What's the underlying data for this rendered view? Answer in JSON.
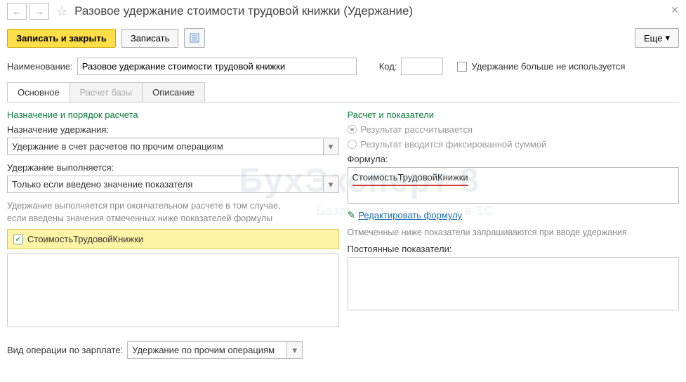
{
  "header": {
    "title": "Разовое удержание стоимости трудовой книжки (Удержание)"
  },
  "toolbar": {
    "save_close": "Записать и закрыть",
    "save": "Записать",
    "more": "Еще"
  },
  "form": {
    "name_label": "Наименование:",
    "name_value": "Разовое удержание стоимости трудовой книжки",
    "code_label": "Код:",
    "code_value": "",
    "not_used_label": "Удержание больше не используется"
  },
  "tabs": {
    "main": "Основное",
    "base": "Расчет базы",
    "desc": "Описание"
  },
  "left": {
    "section": "Назначение и порядок расчета",
    "purpose_label": "Назначение удержания:",
    "purpose_value": "Удержание в счет расчетов по прочим операциям",
    "when_label": "Удержание выполняется:",
    "when_value": "Только если введено значение показателя",
    "hint": "Удержание выполняется при окончательном расчете в том случае,\nесли введены значения отмеченных ниже показателей формулы",
    "indicator": "СтоимостьТрудовойКнижки",
    "op_label": "Вид операции по зарплате:",
    "op_value": "Удержание по прочим операциям"
  },
  "right": {
    "section": "Расчет и показатели",
    "radio_calc": "Результат рассчитывается",
    "radio_fixed": "Результат вводится фиксированной суммой",
    "formula_label": "Формула:",
    "formula_value": "СтоимостьТрудовойКнижки",
    "edit_link": "Редактировать формулу",
    "ask_hint": "Отмеченные ниже показатели запрашиваются при вводе удержания",
    "const_label": "Постоянные показатели:"
  }
}
